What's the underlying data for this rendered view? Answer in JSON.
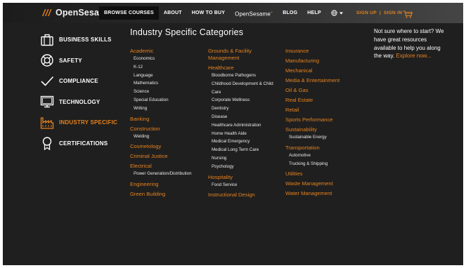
{
  "header": {
    "logo": "OpenSesame",
    "nav": [
      {
        "label": "BROWSE COURSES",
        "active": true
      },
      {
        "label": "ABOUT"
      },
      {
        "label": "HOW TO BUY"
      },
      {
        "label": "OpenSesame"
      },
      {
        "label": "BLOG"
      },
      {
        "label": "HELP"
      }
    ],
    "nav_superscript": "+",
    "auth": {
      "sign_up": "SIGN UP",
      "separator": "|",
      "sign_in": "SIGN IN"
    },
    "accent": "#e6821e"
  },
  "sidebar": [
    {
      "label": "BUSINESS SKILLS",
      "icon": "briefcase-icon"
    },
    {
      "label": "SAFETY",
      "icon": "life-ring-icon"
    },
    {
      "label": "COMPLIANCE",
      "icon": "checkmark-icon"
    },
    {
      "label": "TECHNOLOGY",
      "icon": "monitor-icon"
    },
    {
      "label": "INDUSTRY SPECIFIC",
      "icon": "factory-icon",
      "active": true
    },
    {
      "label": "CERTIFICATIONS",
      "icon": "ribbon-award-icon"
    }
  ],
  "main": {
    "heading": "Industry Specific Categories",
    "columns": [
      [
        {
          "label": "Academic",
          "subs": [
            "Economics",
            "K-12",
            "Language",
            "Mathematics",
            "Science",
            "Special Education",
            "Writing"
          ]
        },
        {
          "label": "Banking",
          "subs": []
        },
        {
          "label": "Construction",
          "subs": [
            "Welding"
          ]
        },
        {
          "label": "Cosmetology",
          "subs": []
        },
        {
          "label": "Criminal Justice",
          "subs": []
        },
        {
          "label": "Electrical",
          "subs": [
            "Power Generation/Distribution"
          ]
        },
        {
          "label": "Engineering",
          "subs": []
        },
        {
          "label": "Green Building",
          "subs": []
        }
      ],
      [
        {
          "label": "Grounds & Facility Management",
          "subs": []
        },
        {
          "label": "Healthcare",
          "subs": [
            "Bloodborne Pathogens",
            "Childhood Development & Child Care",
            "Corporate Wellness",
            "Dentistry",
            "Disease",
            "Healthcare Administration",
            "Home Health Aide",
            "Medical Emergency",
            "Medical Long Term Care",
            "Nursing",
            "Psychology"
          ]
        },
        {
          "label": "Hospitality",
          "subs": [
            "Food Service"
          ]
        },
        {
          "label": "Instructional Design",
          "subs": []
        }
      ],
      [
        {
          "label": "Insurance",
          "subs": []
        },
        {
          "label": "Manufacturing",
          "subs": []
        },
        {
          "label": "Mechanical",
          "subs": []
        },
        {
          "label": "Media & Entertainment",
          "subs": []
        },
        {
          "label": "Oil & Gas",
          "subs": []
        },
        {
          "label": "Real Estate",
          "subs": []
        },
        {
          "label": "Retail",
          "subs": []
        },
        {
          "label": "Sports Performance",
          "subs": []
        },
        {
          "label": "Sustainability",
          "subs": [
            "Sustainable Energy"
          ]
        },
        {
          "label": "Transportation",
          "subs": [
            "Automotive",
            "Trucking & Shipping"
          ]
        },
        {
          "label": "Utilities",
          "subs": []
        },
        {
          "label": "Waste Management",
          "subs": []
        },
        {
          "label": "Water Management",
          "subs": []
        }
      ]
    ]
  },
  "aside": {
    "text": "Not sure where to start? We have great resources available to help you along the way.",
    "link": "Explore now..."
  }
}
